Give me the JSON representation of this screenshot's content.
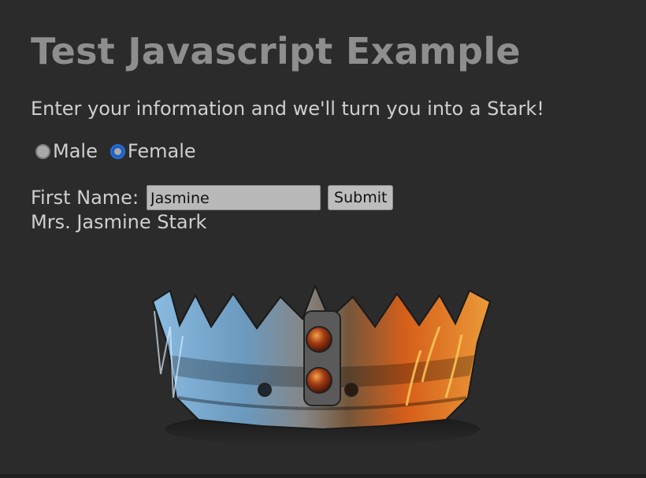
{
  "title": "Test Javascript Example",
  "intro": "Enter your information and we'll turn you into a Stark!",
  "gender": {
    "options": [
      {
        "label": "Male",
        "checked": false
      },
      {
        "label": "Female",
        "checked": true
      }
    ]
  },
  "form": {
    "first_name_label": "First Name:",
    "first_name_value": "Jasmine",
    "submit_label": "Submit"
  },
  "result": "Mrs. Jasmine Stark",
  "image": {
    "icon": "crown-icon",
    "colors": {
      "ice": "#8fc3ea",
      "fire": "#f07a22",
      "metal": "#8c8c8c"
    }
  }
}
